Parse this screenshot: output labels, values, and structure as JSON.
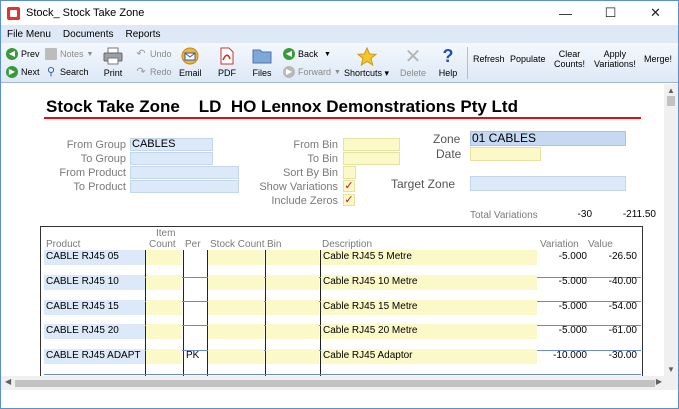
{
  "window": {
    "title": "Stock_ Stock Take Zone"
  },
  "menu": [
    "File Menu",
    "Documents",
    "Reports"
  ],
  "toolbar": {
    "prev": "Prev",
    "next": "Next",
    "notes": "Notes",
    "search": "Search",
    "undo": "Undo",
    "redo": "Redo",
    "print": "Print",
    "email": "Email",
    "pdf": "PDF",
    "files": "Files",
    "back": "Back",
    "forward": "Forward",
    "shortcuts": "Shortcuts",
    "delete": "Delete",
    "help": "Help",
    "refresh": "Refresh",
    "populate": "Populate",
    "clear_counts_1": "Clear",
    "clear_counts_2": "Counts!",
    "apply_variations_1": "Apply",
    "apply_variations_2": "Variations!",
    "merge": "Merge!"
  },
  "report": {
    "title": "Stock Take Zone    LD  HO Lennox Demonstrations Pty Ltd"
  },
  "filters": {
    "from_group_label": "From Group",
    "from_group": "CABLES",
    "to_group_label": "To Group",
    "to_group": "",
    "from_product_label": "From Product",
    "from_product": "",
    "to_product_label": "To Product",
    "to_product": "",
    "from_bin_label": "From Bin",
    "from_bin": "",
    "to_bin_label": "To Bin",
    "to_bin": "",
    "sort_by_bin_label": "Sort By Bin",
    "sort_by_bin": "",
    "show_variations_label": "Show Variations",
    "show_variations": "✓",
    "include_zeros_label": "Include Zeros",
    "include_zeros": "✓",
    "zone_label": "Zone",
    "zone": "01 CABLES",
    "date_label": "Date",
    "date": "",
    "target_zone_label": "Target Zone",
    "target_zone": ""
  },
  "totals": {
    "label": "Total Variations",
    "variation": "-30",
    "value": "-211.50"
  },
  "table": {
    "headers": {
      "product": "Product",
      "item_count_1": "Item",
      "item_count_2": "Count",
      "per": "Per",
      "stock_count": "Stock Count",
      "bin": "Bin",
      "description": "Description",
      "variation": "Variation",
      "value": "Value"
    },
    "rows": [
      {
        "product": "CABLE RJ45 05",
        "item_count": "",
        "per": "",
        "stock_count": "",
        "bin": "",
        "description": "Cable RJ45 5 Metre",
        "variation": "-5.000",
        "value": "-26.50"
      },
      {
        "product": "CABLE RJ45 10",
        "item_count": "",
        "per": "",
        "stock_count": "",
        "bin": "",
        "description": "Cable RJ45 10 Metre",
        "variation": "-5.000",
        "value": "-40.00"
      },
      {
        "product": "CABLE RJ45 15",
        "item_count": "",
        "per": "",
        "stock_count": "",
        "bin": "",
        "description": "Cable RJ45 15 Metre",
        "variation": "-5.000",
        "value": "-54.00"
      },
      {
        "product": "CABLE RJ45 20",
        "item_count": "",
        "per": "",
        "stock_count": "",
        "bin": "",
        "description": "Cable RJ45 20 Metre",
        "variation": "-5.000",
        "value": "-61.00"
      },
      {
        "product": "CABLE RJ45 ADAPT",
        "item_count": "",
        "per": "PK",
        "stock_count": "",
        "bin": "",
        "description": "Cable RJ45 Adaptor",
        "variation": "-10.000",
        "value": "-30.00"
      }
    ]
  }
}
